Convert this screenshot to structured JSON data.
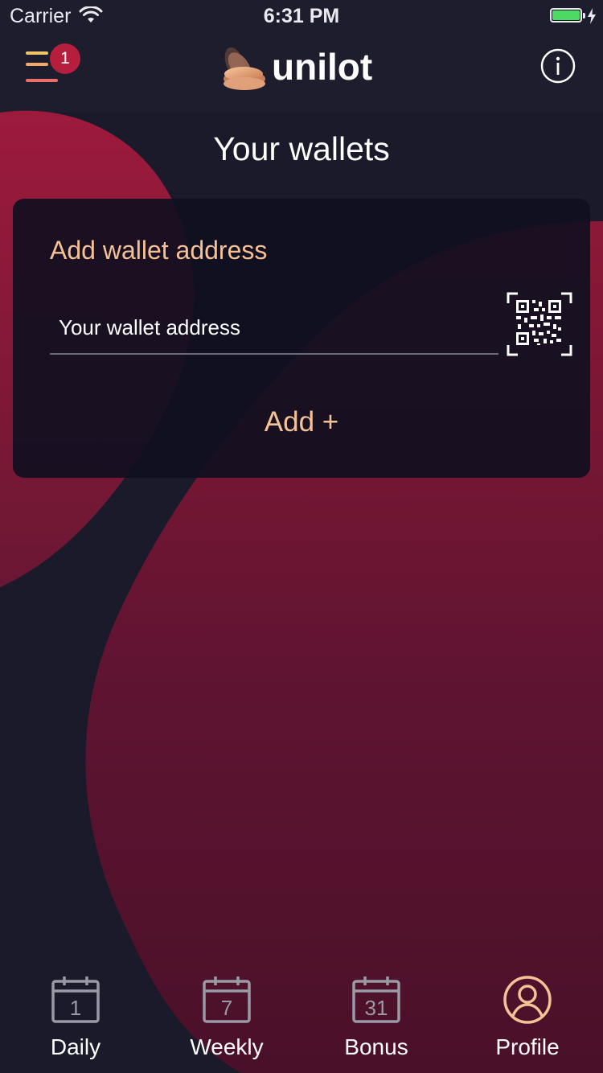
{
  "status_bar": {
    "carrier": "Carrier",
    "time": "6:31 PM"
  },
  "header": {
    "menu_badge": "1",
    "logo_text": "unilot"
  },
  "page": {
    "title": "Your wallets"
  },
  "wallet_card": {
    "title": "Add wallet address",
    "input_placeholder": "Your wallet address",
    "input_value": "",
    "add_label": "Add +"
  },
  "tabs": [
    {
      "label": "Daily",
      "icon": "calendar-1-icon",
      "day": "1",
      "active": false
    },
    {
      "label": "Weekly",
      "icon": "calendar-7-icon",
      "day": "7",
      "active": false
    },
    {
      "label": "Bonus",
      "icon": "calendar-31-icon",
      "day": "31",
      "active": false
    },
    {
      "label": "Profile",
      "icon": "user-icon",
      "active": true
    }
  ],
  "colors": {
    "background": "#1c1b2b",
    "accent_red": "#a3193b",
    "accent_peach": "#f5c197",
    "badge": "#b51e3c",
    "battery": "#4cd964"
  }
}
